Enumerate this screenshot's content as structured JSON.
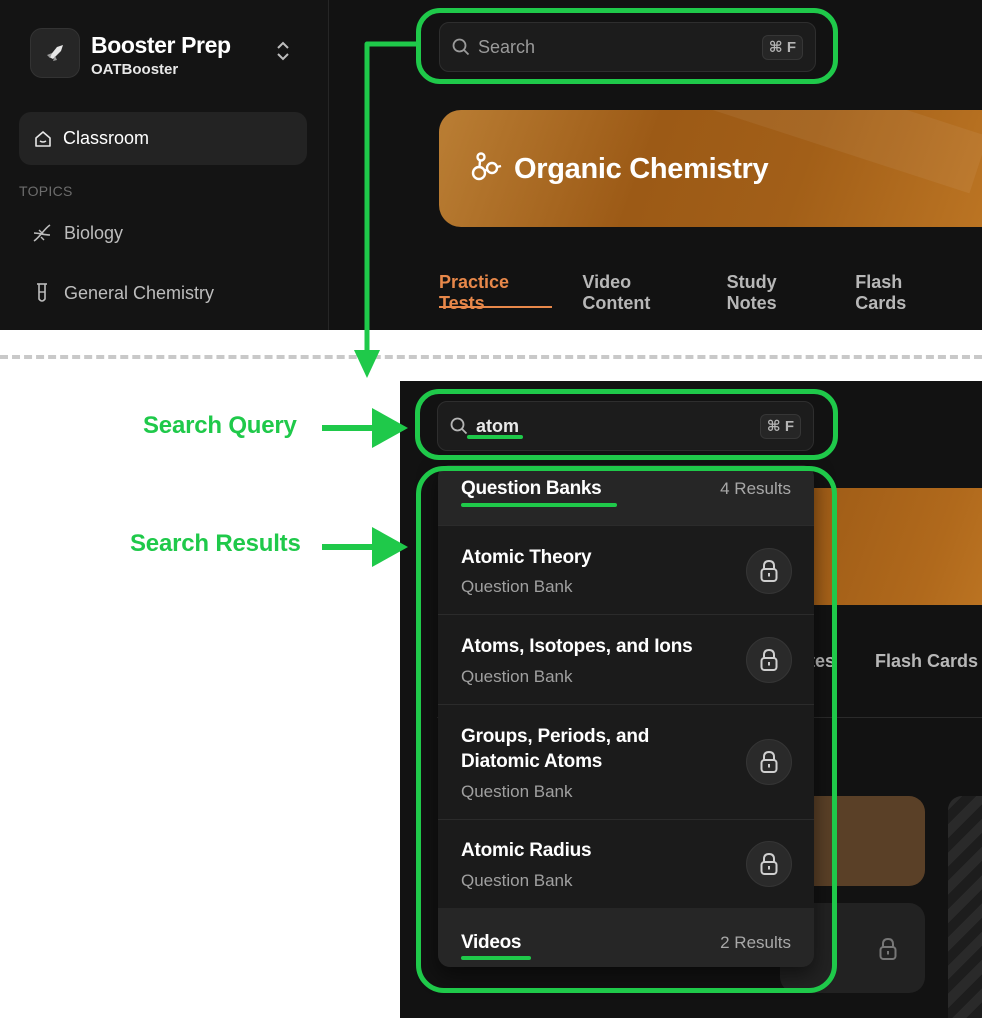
{
  "app": {
    "name": "Booster Prep",
    "subtitle": "OATBooster"
  },
  "sidebar": {
    "classroom_label": "Classroom",
    "topics_heading": "TOPICS",
    "topics": [
      {
        "label": "Biology"
      },
      {
        "label": "General Chemistry"
      }
    ]
  },
  "search": {
    "placeholder": "Search",
    "shortcut": "⌘ F",
    "query": "atom"
  },
  "banner": {
    "title": "Organic Chemistry"
  },
  "tabs": [
    {
      "label": "Practice Tests"
    },
    {
      "label": "Video Content"
    },
    {
      "label": "Study Notes"
    },
    {
      "label": "Flash Cards"
    }
  ],
  "background_tabs": {
    "partial": "otes",
    "flash_cards": "Flash Cards"
  },
  "results": {
    "question_banks": {
      "heading": "Question Banks",
      "count": "4 Results",
      "items": [
        {
          "title": "Atomic Theory",
          "type": "Question Bank"
        },
        {
          "title": "Atoms, Isotopes, and Ions",
          "type": "Question Bank"
        },
        {
          "title": "Groups, Periods, and Diatomic Atoms",
          "type": "Question Bank"
        },
        {
          "title": "Atomic Radius",
          "type": "Question Bank"
        }
      ]
    },
    "videos": {
      "heading": "Videos",
      "count": "2 Results"
    }
  },
  "annotations": {
    "search_query": "Search Query",
    "search_results": "Search Results"
  },
  "colors": {
    "highlight": "#1fc94a",
    "accent": "#e8884a",
    "background": "#121212"
  }
}
